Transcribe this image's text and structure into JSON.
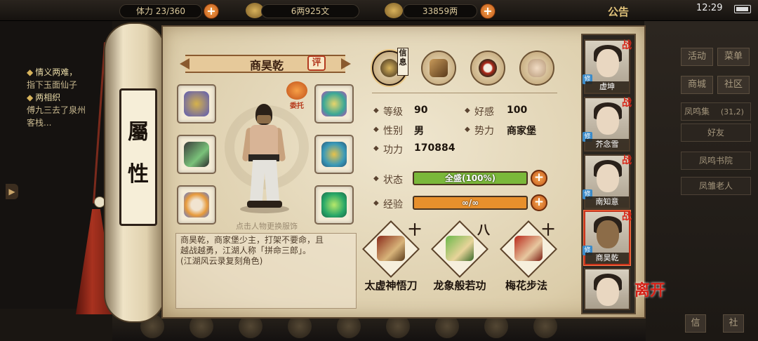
{
  "topbar": {
    "stamina_label": "体力",
    "stamina_value": "23/360",
    "copper": "6两925文",
    "silver": "33859两",
    "notice": "公告",
    "clock": "12:29"
  },
  "quest_panel": {
    "lines": [
      {
        "text": "情义两难，",
        "bullet": true
      },
      {
        "text": "指下玉面仙子",
        "bullet": false
      },
      {
        "text": "两相织",
        "bullet": true
      },
      {
        "text": "傅九三去了泉州",
        "bullet": false
      },
      {
        "text": "客栈...",
        "bullet": false
      }
    ]
  },
  "side_menu": {
    "row1": [
      "活动",
      "菜单"
    ],
    "row2": [
      "商城",
      "社区"
    ],
    "location": "凤鸣集",
    "location_coords": "(31,2)",
    "friends_tab": "好友",
    "npcs": [
      "凤鸣书院",
      "凤雏老人"
    ],
    "bottom_left": "信",
    "bottom_right": "社"
  },
  "scroll": {
    "title_top": "屬",
    "title_bottom": "性"
  },
  "character": {
    "name": "商昊乾",
    "eval_label": "评",
    "commission_label": "委托",
    "change_outfit_hint": "点击人物更换服饰",
    "bio_lines": [
      "商昊乾，商家堡少主，打架不要命，且",
      "越战越勇，江湖人称「拼命三郎」。",
      "(江湖风云录复刻角色)"
    ]
  },
  "tabs": {
    "info_badge": "信息"
  },
  "stats": {
    "level_label": "等级",
    "level_value": "90",
    "favor_label": "好感",
    "favor_value": "100",
    "gender_label": "性别",
    "gender_value": "男",
    "faction_label": "势力",
    "faction_value": "商家堡",
    "power_label": "功力",
    "power_value": "170884",
    "status_label": "状态",
    "status_text": "全盛(100%)",
    "status_fill": 1.0,
    "exp_label": "经验",
    "exp_text": "∞/∞",
    "exp_fill": 1.0,
    "colors": {
      "status_bar": "#7ab83a",
      "exp_bar": "#e8902c"
    }
  },
  "skills": [
    {
      "name": "太虚神悟刀",
      "mark": "十"
    },
    {
      "name": "龙象般若功",
      "mark": "八"
    },
    {
      "name": "梅花步法",
      "mark": "十"
    }
  ],
  "party": {
    "members": [
      {
        "name": "虚坤",
        "battle": "战",
        "cultivate": "修",
        "active": false
      },
      {
        "name": "芥念雪",
        "battle": "战",
        "cultivate": "修",
        "active": false
      },
      {
        "name": "南知意",
        "battle": "战",
        "cultivate": "修",
        "active": false
      },
      {
        "name": "商昊乾",
        "battle": "战",
        "cultivate": "修",
        "active": true
      },
      {
        "name": "",
        "battle": "",
        "cultivate": "",
        "active": false
      }
    ],
    "leave_label": "离开"
  }
}
